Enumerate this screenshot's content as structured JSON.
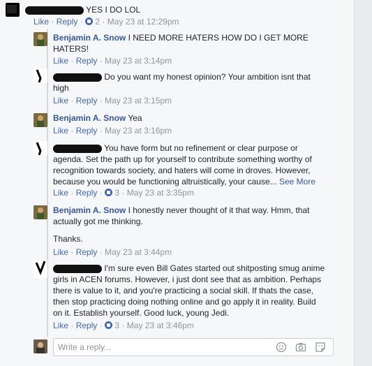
{
  "comments": [
    {
      "text": "YES I DO LOL",
      "actions": {
        "like": "Like",
        "reply": "Reply",
        "reactions": "2",
        "time": "May 23 at 12:29pm"
      }
    },
    {
      "name": "Benjamin A. Snow",
      "text": "I NEED MORE HATERS HOW DO I GET MORE HATERS!",
      "actions": {
        "like": "Like",
        "reply": "Reply",
        "time": "May 23 at 3:14pm"
      }
    },
    {
      "text": "Do you want my honest opinion? Your ambition isnt that high",
      "actions": {
        "like": "Like",
        "reply": "Reply",
        "time": "May 23 at 3:15pm"
      }
    },
    {
      "name": "Benjamin A. Snow",
      "text": "Yea",
      "actions": {
        "like": "Like",
        "reply": "Reply",
        "time": "May 23 at 3:16pm"
      }
    },
    {
      "text": "You have form but no refinement or clear purpose or agenda. Set the path up for yourself to contribute something worthy of recognition towards society, and haters will come in droves. However, because you would be functioning altruistically, your cause...",
      "see_more": "See More",
      "actions": {
        "like": "Like",
        "reply": "Reply",
        "reactions": "3",
        "time": "May 23 at 3:35pm"
      }
    },
    {
      "name": "Benjamin A. Snow",
      "text": "I honestly never thought of it that way. Hmm, that actually got me thinking.",
      "text2": "Thanks.",
      "actions": {
        "like": "Like",
        "reply": "Reply",
        "time": "May 23 at 3:44pm"
      }
    },
    {
      "text": "I'm sure even Bill Gates started out shitposting smug anime girls in ACEN forums. However, i just dont see that as ambition. Perhaps there is value to it, and you're practicing a social skill. If thats the case, then stop practicing doing nothing online and go apply it in reality. Build on it. Establish yourself. Good luck, young Jedi.",
      "actions": {
        "like": "Like",
        "reply": "Reply",
        "reactions": "3",
        "time": "May 23 at 3:46pm"
      }
    }
  ],
  "sep": "·",
  "reply_box": {
    "placeholder": "Write a reply..."
  },
  "icons": [
    "smiley-icon",
    "camera-icon",
    "sticker-icon",
    "like-reaction-icon"
  ]
}
